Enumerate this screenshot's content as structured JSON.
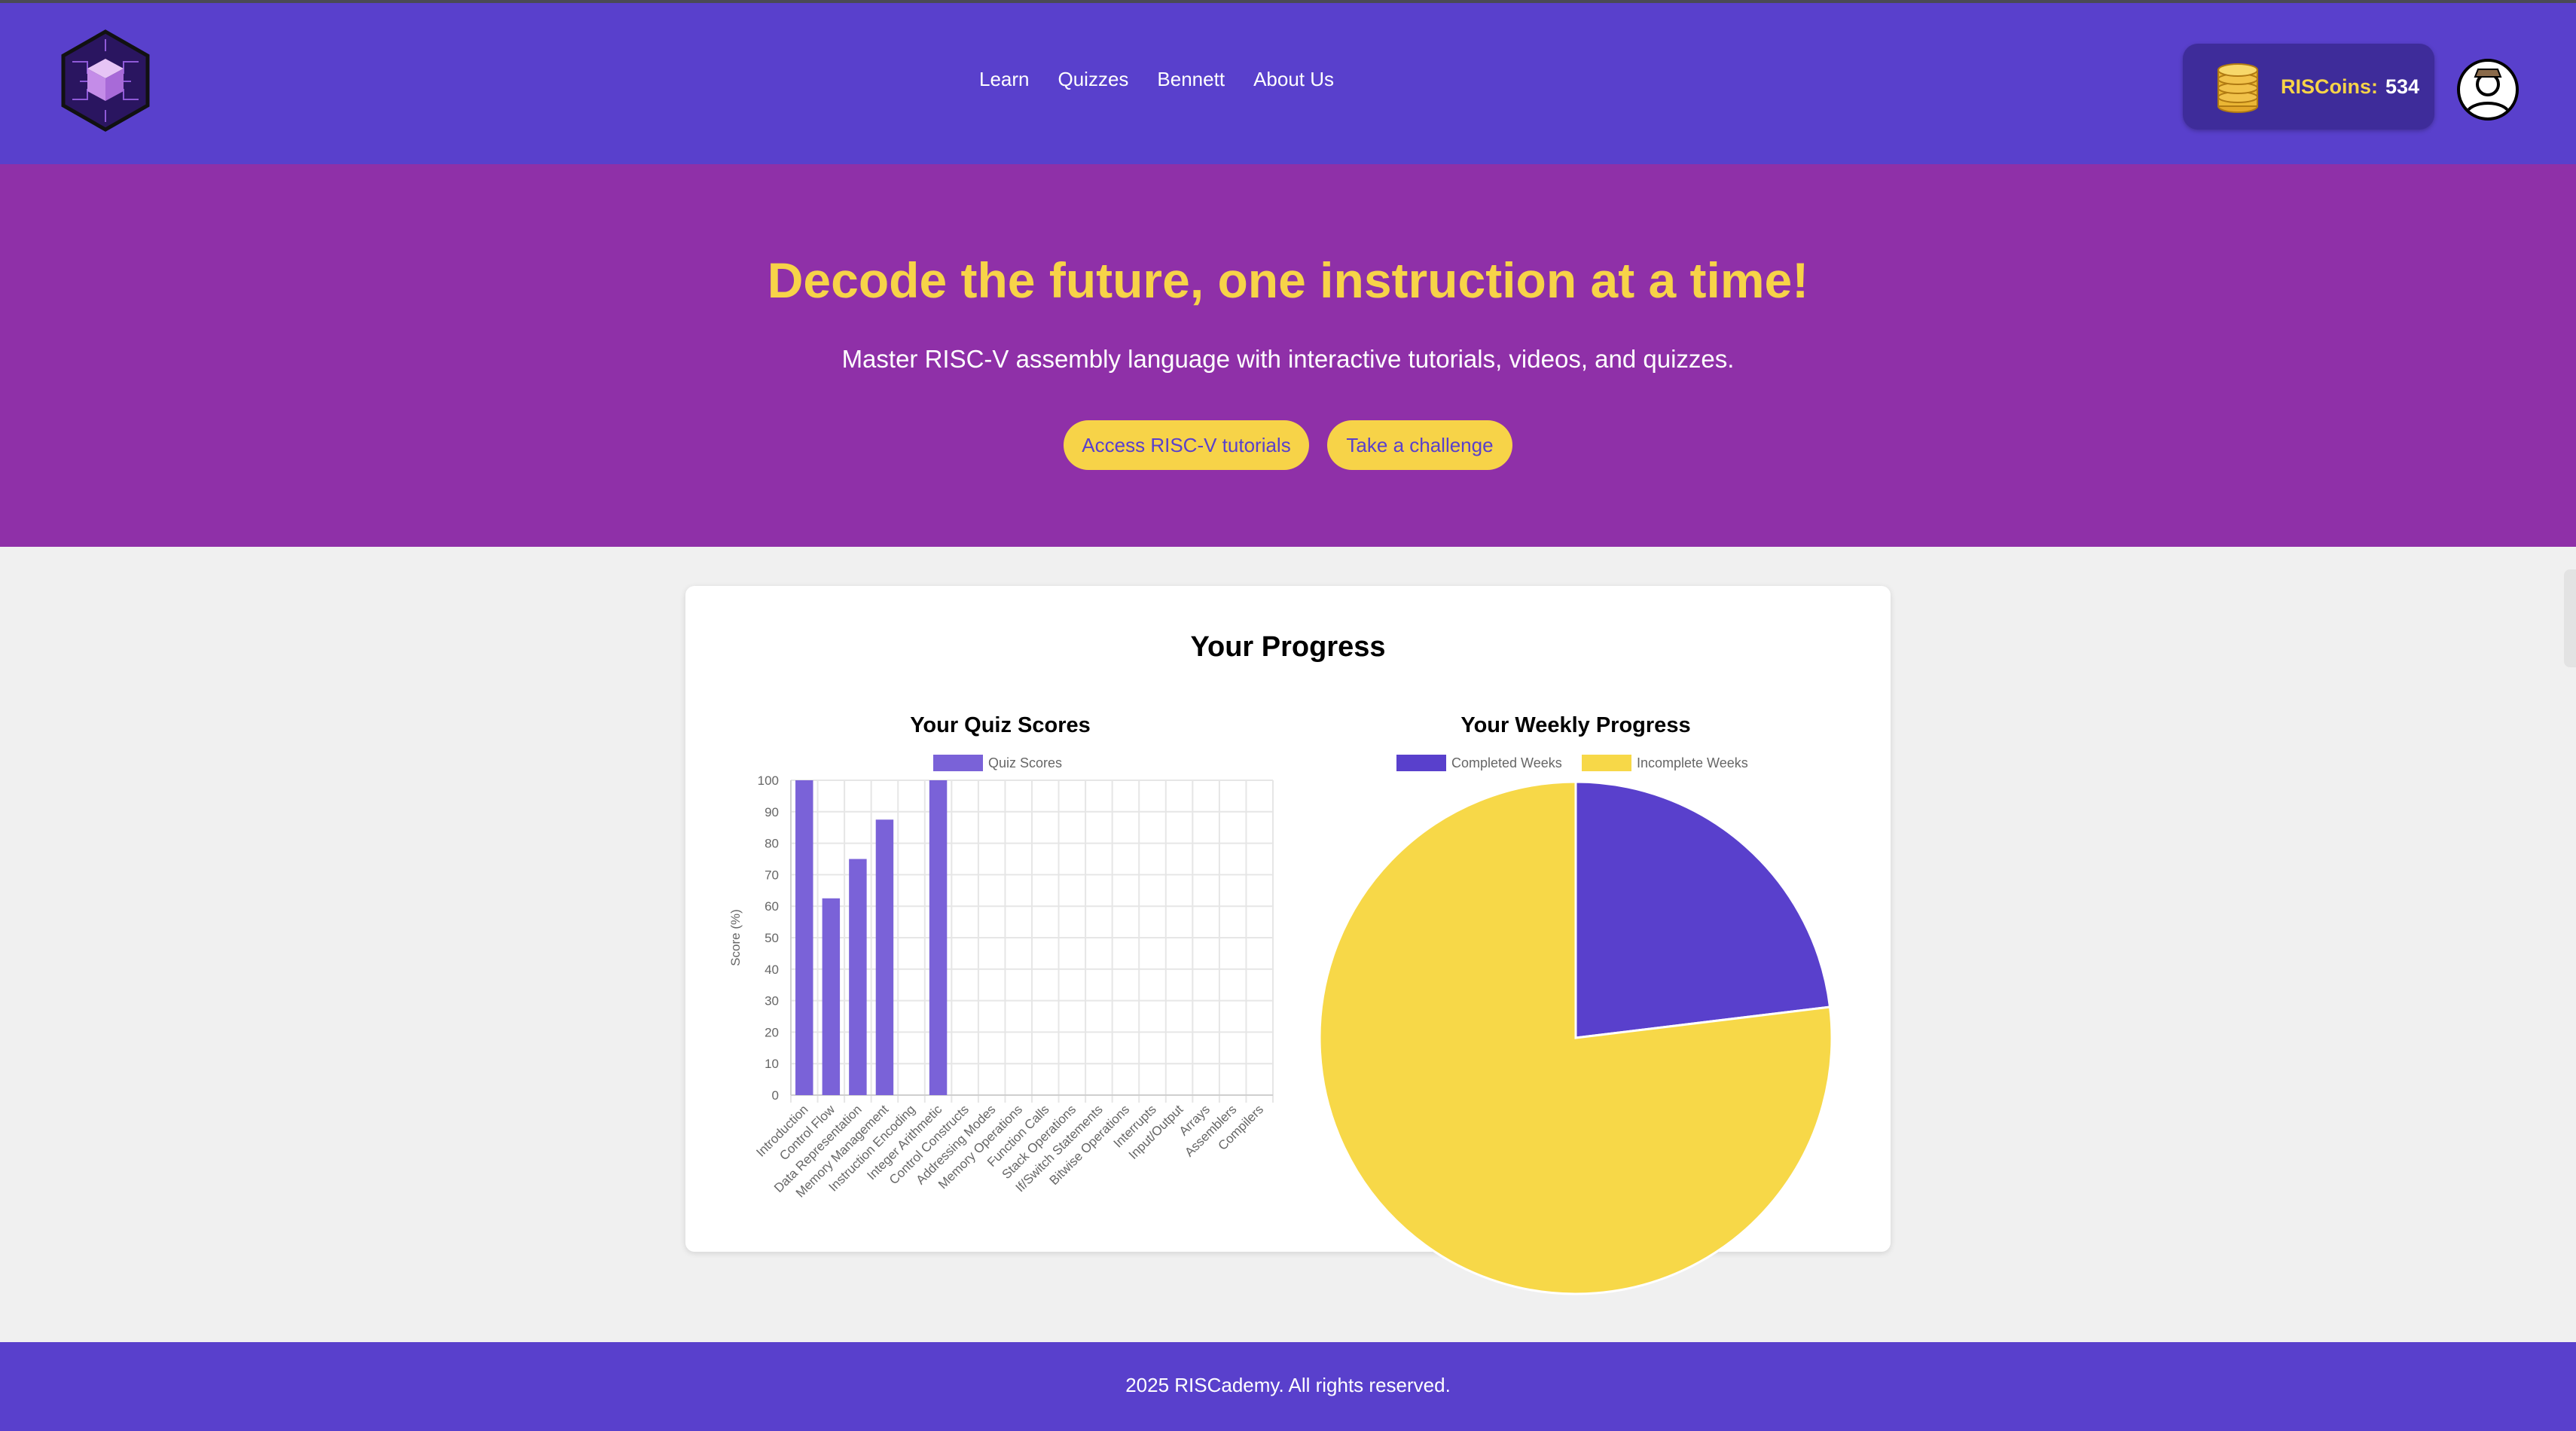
{
  "header": {
    "logo": "riscademy-cube-logo",
    "nav": [
      "Learn",
      "Quizzes",
      "Bennett",
      "About Us"
    ],
    "coins_label": "RISCoins:",
    "coins_value": "534",
    "colors": {
      "brand": "#5940cc",
      "accent": "#f7d348"
    }
  },
  "hero": {
    "title": "Decode the future, one instruction at a time!",
    "subtitle": "Master RISC-V assembly language with interactive tutorials, videos, and quizzes.",
    "primary_button": "Access RISC-V tutorials",
    "secondary_button": "Take a challenge",
    "background": "#8f30a8"
  },
  "progress": {
    "title": "Your Progress"
  },
  "chart_data": [
    {
      "type": "bar",
      "title": "Your Quiz Scores",
      "legend": [
        "Quiz Scores"
      ],
      "legend_position": "top",
      "ylabel": "Score (%)",
      "xlabel": "",
      "ylim": [
        0,
        100
      ],
      "yticks": [
        0,
        10,
        20,
        30,
        40,
        50,
        60,
        70,
        80,
        90,
        100
      ],
      "grid": true,
      "color": "#7a62d8",
      "categories": [
        "Introduction",
        "Control Flow",
        "Data Representation",
        "Memory Management",
        "Instruction Encoding",
        "Integer Arithmetic",
        "Control Constructs",
        "Addressing Modes",
        "Memory Operations",
        "Function Calls",
        "Stack Operations",
        "If/Switch Statements",
        "Bitwise Operations",
        "Interrupts",
        "Input/Output",
        "Arrays",
        "Assemblers",
        "Compilers"
      ],
      "values": [
        100,
        62.5,
        75,
        87.5,
        null,
        100,
        null,
        null,
        null,
        null,
        null,
        null,
        null,
        null,
        null,
        null,
        null,
        null
      ]
    },
    {
      "type": "pie",
      "title": "Your Weekly Progress",
      "legend": [
        "Completed Weeks",
        "Incomplete Weeks"
      ],
      "legend_position": "top",
      "colors": [
        "#5940cc",
        "#f7d848"
      ],
      "values": [
        3,
        10
      ]
    }
  ],
  "footer": {
    "text": "2025 RISCademy. All rights reserved."
  }
}
